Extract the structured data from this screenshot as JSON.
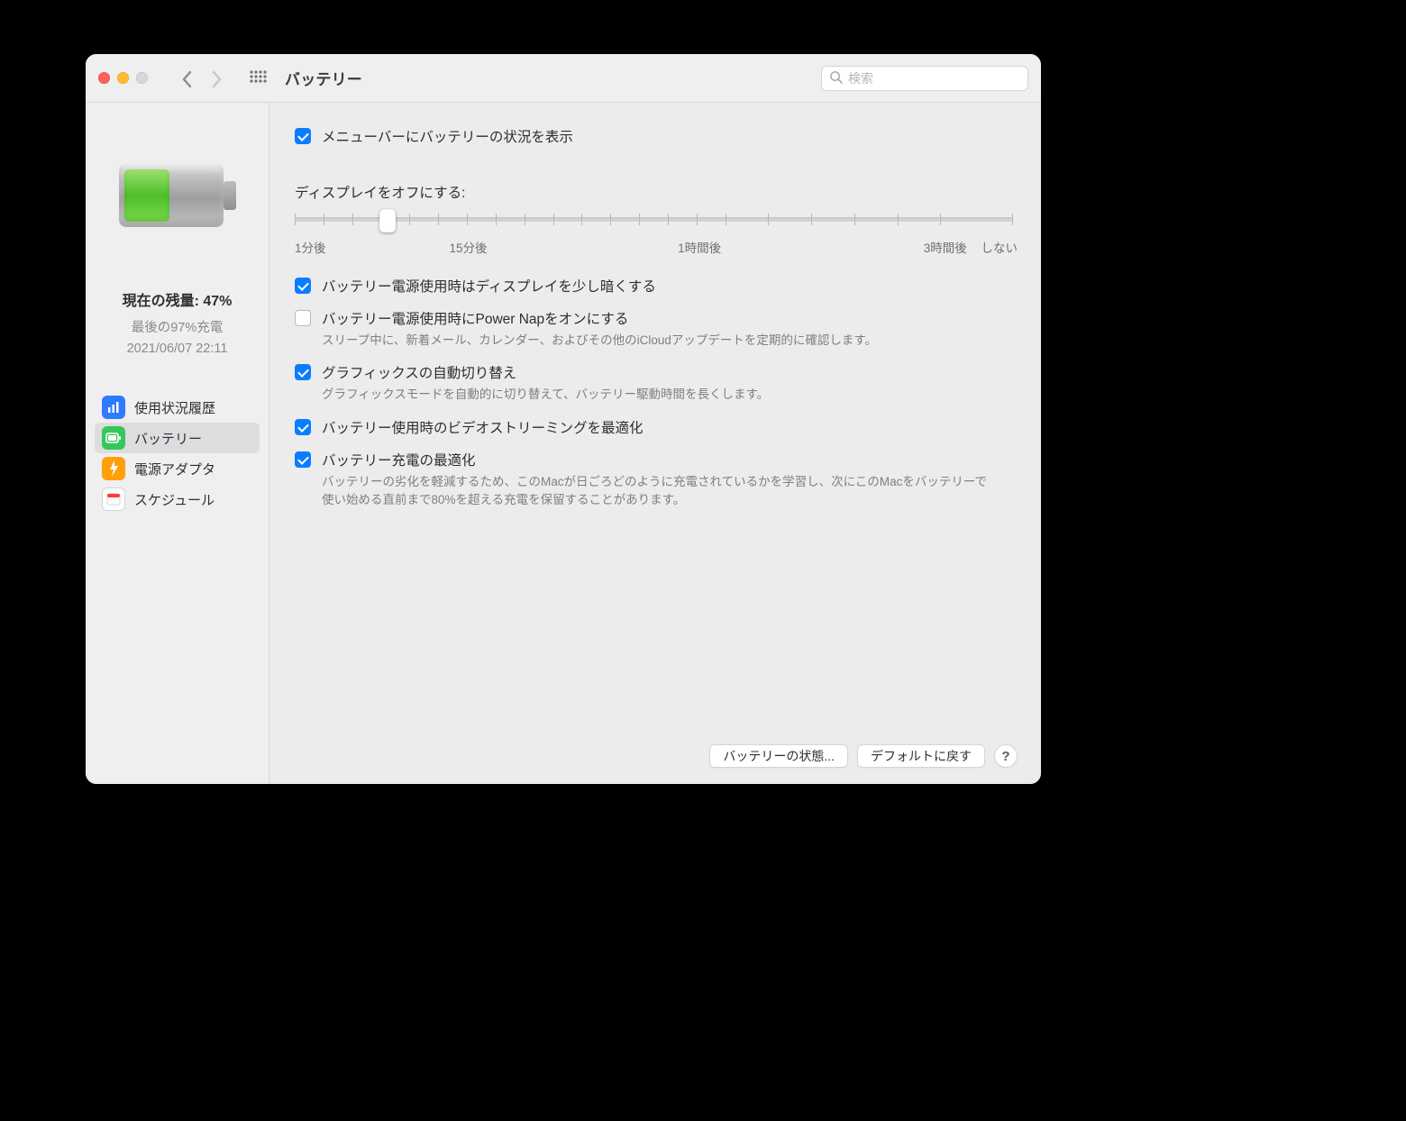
{
  "window": {
    "title": "バッテリー",
    "search_placeholder": "検索"
  },
  "sidebar": {
    "status": {
      "current_label": "現在の残量: 47%",
      "last_charge": "最後の97%充電",
      "timestamp": "2021/06/07 22:11"
    },
    "items": [
      {
        "label": "使用状況履歴",
        "icon": "usage-history-icon",
        "color": "#2f7bff",
        "selected": false
      },
      {
        "label": "バッテリー",
        "icon": "battery-icon",
        "color": "#34c759",
        "selected": true
      },
      {
        "label": "電源アダプタ",
        "icon": "power-adapter-icon",
        "color": "#ff9f0a",
        "selected": false
      },
      {
        "label": "スケジュール",
        "icon": "schedule-icon",
        "color": "#ffffff",
        "selected": false
      }
    ]
  },
  "main": {
    "show_in_menubar": {
      "checked": true,
      "label": "メニューバーにバッテリーの状況を表示"
    },
    "display_off": {
      "title": "ディスプレイをオフにする:",
      "value_percent": 13,
      "ticks": [
        {
          "percent": 0,
          "label": "1分後"
        },
        {
          "percent": 24,
          "label": "15分後"
        },
        {
          "percent": 56,
          "label": "1時間後"
        },
        {
          "percent": 90,
          "label": "3時間後"
        },
        {
          "percent": 100,
          "label": "しない"
        }
      ],
      "minor_ticks": [
        4,
        8,
        12,
        16,
        20,
        28,
        32,
        36,
        40,
        44,
        48,
        52,
        60,
        66,
        72,
        78,
        84
      ]
    },
    "options": [
      {
        "checked": true,
        "label": "バッテリー電源使用時はディスプレイを少し暗くする",
        "sub": ""
      },
      {
        "checked": false,
        "label": "バッテリー電源使用時にPower Napをオンにする",
        "sub": "スリープ中に、新着メール、カレンダー、およびその他のiCloudアップデートを定期的に確認します。"
      },
      {
        "checked": true,
        "label": "グラフィックスの自動切り替え",
        "sub": "グラフィックスモードを自動的に切り替えて、バッテリー駆動時間を長くします。"
      },
      {
        "checked": true,
        "label": "バッテリー使用時のビデオストリーミングを最適化",
        "sub": ""
      },
      {
        "checked": true,
        "label": "バッテリー充電の最適化",
        "sub": "バッテリーの劣化を軽減するため、このMacが日ごろどのように充電されているかを学習し、次にこのMacをバッテリーで使い始める直前まで80%を超える充電を保留することがあります。"
      }
    ],
    "footer": {
      "battery_health": "バッテリーの状態...",
      "restore_defaults": "デフォルトに戻す",
      "help": "?"
    }
  }
}
